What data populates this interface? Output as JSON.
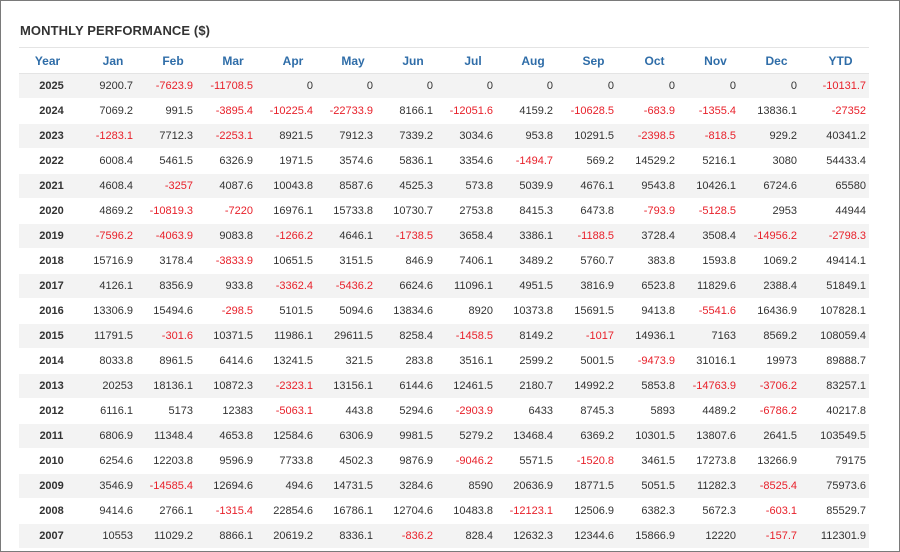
{
  "title": "MONTHLY PERFORMANCE ($)",
  "colors": {
    "negative": "#e8202a",
    "header": "#2f6da8",
    "text": "#333333",
    "row_alt": "#f3f3f3"
  },
  "columns": [
    "Year",
    "Jan",
    "Feb",
    "Mar",
    "Apr",
    "May",
    "Jun",
    "Jul",
    "Aug",
    "Sep",
    "Oct",
    "Nov",
    "Dec",
    "YTD"
  ],
  "rows": [
    {
      "year": "2025",
      "values": [
        "9200.7",
        "-7623.9",
        "-11708.5",
        "0",
        "0",
        "0",
        "0",
        "0",
        "0",
        "0",
        "0",
        "0",
        "-10131.7"
      ]
    },
    {
      "year": "2024",
      "values": [
        "7069.2",
        "991.5",
        "-3895.4",
        "-10225.4",
        "-22733.9",
        "8166.1",
        "-12051.6",
        "4159.2",
        "-10628.5",
        "-683.9",
        "-1355.4",
        "13836.1",
        "-27352"
      ]
    },
    {
      "year": "2023",
      "values": [
        "-1283.1",
        "7712.3",
        "-2253.1",
        "8921.5",
        "7912.3",
        "7339.2",
        "3034.6",
        "953.8",
        "10291.5",
        "-2398.5",
        "-818.5",
        "929.2",
        "40341.2"
      ]
    },
    {
      "year": "2022",
      "values": [
        "6008.4",
        "5461.5",
        "6326.9",
        "1971.5",
        "3574.6",
        "5836.1",
        "3354.6",
        "-1494.7",
        "569.2",
        "14529.2",
        "5216.1",
        "3080",
        "54433.4"
      ]
    },
    {
      "year": "2021",
      "values": [
        "4608.4",
        "-3257",
        "4087.6",
        "10043.8",
        "8587.6",
        "4525.3",
        "573.8",
        "5039.9",
        "4676.1",
        "9543.8",
        "10426.1",
        "6724.6",
        "65580"
      ]
    },
    {
      "year": "2020",
      "values": [
        "4869.2",
        "-10819.3",
        "-7220",
        "16976.1",
        "15733.8",
        "10730.7",
        "2753.8",
        "8415.3",
        "6473.8",
        "-793.9",
        "-5128.5",
        "2953",
        "44944"
      ]
    },
    {
      "year": "2019",
      "values": [
        "-7596.2",
        "-4063.9",
        "9083.8",
        "-1266.2",
        "4646.1",
        "-1738.5",
        "3658.4",
        "3386.1",
        "-1188.5",
        "3728.4",
        "3508.4",
        "-14956.2",
        "-2798.3"
      ]
    },
    {
      "year": "2018",
      "values": [
        "15716.9",
        "3178.4",
        "-3833.9",
        "10651.5",
        "3151.5",
        "846.9",
        "7406.1",
        "3489.2",
        "5760.7",
        "383.8",
        "1593.8",
        "1069.2",
        "49414.1"
      ]
    },
    {
      "year": "2017",
      "values": [
        "4126.1",
        "8356.9",
        "933.8",
        "-3362.4",
        "-5436.2",
        "6624.6",
        "11096.1",
        "4951.5",
        "3816.9",
        "6523.8",
        "11829.6",
        "2388.4",
        "51849.1"
      ]
    },
    {
      "year": "2016",
      "values": [
        "13306.9",
        "15494.6",
        "-298.5",
        "5101.5",
        "5094.6",
        "13834.6",
        "8920",
        "10373.8",
        "15691.5",
        "9413.8",
        "-5541.6",
        "16436.9",
        "107828.1"
      ]
    },
    {
      "year": "2015",
      "values": [
        "11791.5",
        "-301.6",
        "10371.5",
        "11986.1",
        "29611.5",
        "8258.4",
        "-1458.5",
        "8149.2",
        "-1017",
        "14936.1",
        "7163",
        "8569.2",
        "108059.4"
      ]
    },
    {
      "year": "2014",
      "values": [
        "8033.8",
        "8961.5",
        "6414.6",
        "13241.5",
        "321.5",
        "283.8",
        "3516.1",
        "2599.2",
        "5001.5",
        "-9473.9",
        "31016.1",
        "19973",
        "89888.7"
      ]
    },
    {
      "year": "2013",
      "values": [
        "20253",
        "18136.1",
        "10872.3",
        "-2323.1",
        "13156.1",
        "6144.6",
        "12461.5",
        "2180.7",
        "14992.2",
        "5853.8",
        "-14763.9",
        "-3706.2",
        "83257.1"
      ]
    },
    {
      "year": "2012",
      "values": [
        "6116.1",
        "5173",
        "12383",
        "-5063.1",
        "443.8",
        "5294.6",
        "-2903.9",
        "6433",
        "8745.3",
        "5893",
        "4489.2",
        "-6786.2",
        "40217.8"
      ]
    },
    {
      "year": "2011",
      "values": [
        "6806.9",
        "11348.4",
        "4653.8",
        "12584.6",
        "6306.9",
        "9981.5",
        "5279.2",
        "13468.4",
        "6369.2",
        "10301.5",
        "13807.6",
        "2641.5",
        "103549.5"
      ]
    },
    {
      "year": "2010",
      "values": [
        "6254.6",
        "12203.8",
        "9596.9",
        "7733.8",
        "4502.3",
        "9876.9",
        "-9046.2",
        "5571.5",
        "-1520.8",
        "3461.5",
        "17273.8",
        "13266.9",
        "79175"
      ]
    },
    {
      "year": "2009",
      "values": [
        "3546.9",
        "-14585.4",
        "12694.6",
        "494.6",
        "14731.5",
        "3284.6",
        "8590",
        "20636.9",
        "18771.5",
        "5051.5",
        "11282.3",
        "-8525.4",
        "75973.6"
      ]
    },
    {
      "year": "2008",
      "values": [
        "9414.6",
        "2766.1",
        "-1315.4",
        "22854.6",
        "16786.1",
        "12704.6",
        "10483.8",
        "-12123.1",
        "12506.9",
        "6382.3",
        "5672.3",
        "-603.1",
        "85529.7"
      ]
    },
    {
      "year": "2007",
      "values": [
        "10553",
        "11029.2",
        "8866.1",
        "20619.2",
        "8336.1",
        "-836.2",
        "828.4",
        "12632.3",
        "12344.6",
        "15866.9",
        "12220",
        "-157.7",
        "112301.9"
      ]
    }
  ]
}
